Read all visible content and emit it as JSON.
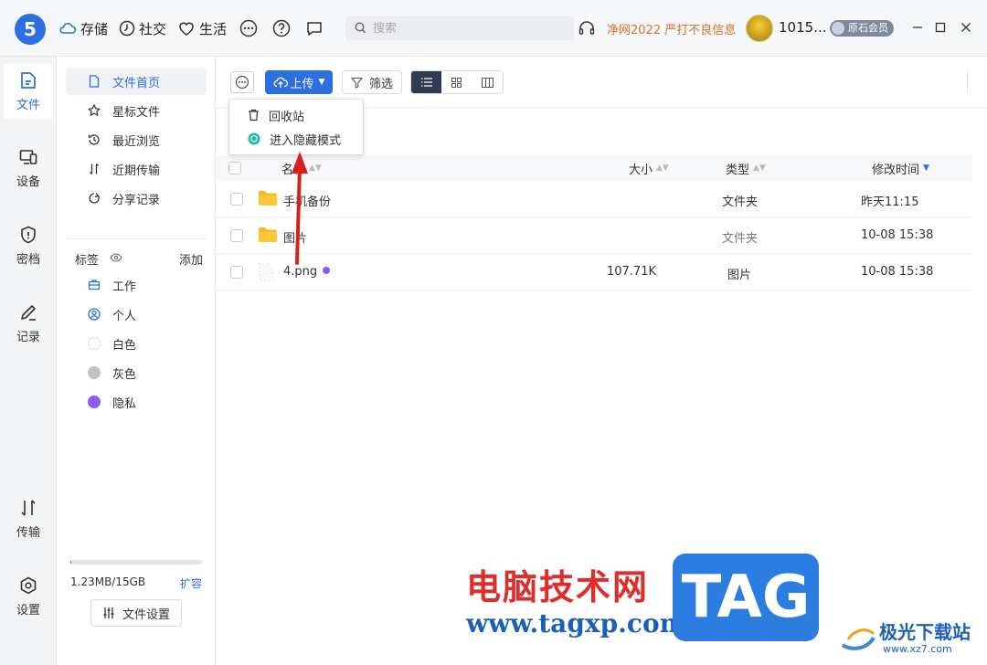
{
  "app": {
    "logo_text": "5",
    "topnav": [
      {
        "label": "存储",
        "icon": "cloud-icon"
      },
      {
        "label": "社交",
        "icon": "clock-icon"
      },
      {
        "label": "生活",
        "icon": "heart-icon"
      }
    ],
    "search_placeholder": "搜索",
    "promo_text": "净网2022 严打不良信息",
    "username": "1015...",
    "member_badge": "原石会员"
  },
  "left_rail": [
    {
      "label": "文件",
      "icon": "file-icon",
      "active": true
    },
    {
      "label": "设备",
      "icon": "device-icon",
      "active": false
    },
    {
      "label": "密档",
      "icon": "shield-icon",
      "active": false
    },
    {
      "label": "记录",
      "icon": "pencil-icon",
      "active": false
    },
    {
      "label": "传输",
      "icon": "transfer-icon",
      "active": false
    },
    {
      "label": "设置",
      "icon": "settings-icon",
      "active": false
    }
  ],
  "sidebar": {
    "items": [
      {
        "label": "文件首页",
        "icon": "file-home-icon",
        "active": true
      },
      {
        "label": "星标文件",
        "icon": "star-icon",
        "active": false
      },
      {
        "label": "最近浏览",
        "icon": "history-icon",
        "active": false
      },
      {
        "label": "近期传输",
        "icon": "transfer-icon",
        "active": false
      },
      {
        "label": "分享记录",
        "icon": "share-icon",
        "active": false
      }
    ],
    "tags_title": "标签",
    "tags_add": "添加",
    "tags": [
      {
        "label": "工作",
        "icon": "briefcase-icon",
        "color": "#2b6fe0"
      },
      {
        "label": "个人",
        "icon": "person-icon",
        "color": "#2b6fe0"
      },
      {
        "label": "白色",
        "color": "#ffffff"
      },
      {
        "label": "灰色",
        "color": "#c4c4c4"
      },
      {
        "label": "隐私",
        "color": "#8a5cf6"
      }
    ],
    "storage_text": "1.23MB/15GB",
    "storage_fraction": 0.0001,
    "storage_expand": "扩容",
    "file_settings": "文件设置"
  },
  "toolbar": {
    "upload_label": "上传",
    "filter_label": "筛选",
    "dropdown": [
      {
        "label": "回收站",
        "icon": "trash-icon"
      },
      {
        "label": "进入隐藏模式",
        "icon": "hidden-mode-icon"
      }
    ],
    "bracket_text": "]"
  },
  "table": {
    "headers": {
      "name": "名称",
      "size": "大小",
      "type": "类型",
      "modified": "修改时间"
    },
    "rows": [
      {
        "name": "手机备份",
        "size": "",
        "type": "文件夹",
        "modified": "昨天11:15",
        "kind": "folder"
      },
      {
        "name": "图片",
        "size": "",
        "type": "文件夹",
        "modified": "10-08 15:38",
        "kind": "folder"
      },
      {
        "name": "4.png",
        "size": "107.71K",
        "type": "图片",
        "modified": "10-08 15:38",
        "kind": "image",
        "tag_color": "#8a5cf6"
      }
    ]
  },
  "watermark": {
    "cn_title": "电脑技术网",
    "url": "www.tagxp.com",
    "tag": "TAG",
    "site_name": "极光下载站",
    "site_url": "www.xz7.com"
  }
}
